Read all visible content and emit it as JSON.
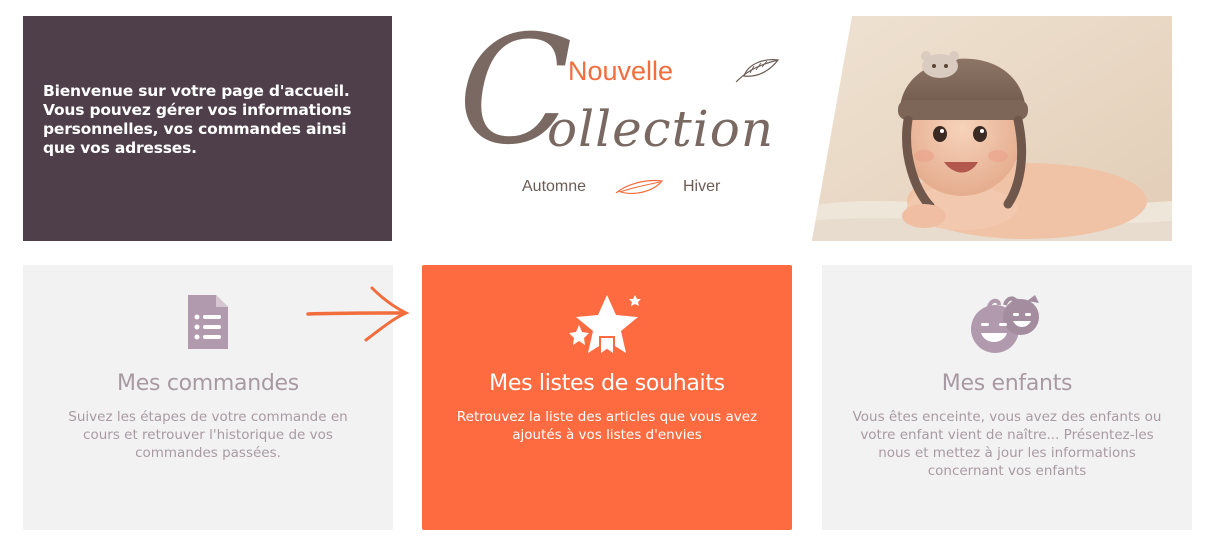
{
  "welcome": {
    "text": "Bienvenue sur votre page d'accueil. Vous pouvez gérer vos informations personnelles, vos commandes ainsi que vos adresses."
  },
  "banner": {
    "nouvelle": "Nouvelle",
    "big_letter": "C",
    "rest": "ollection",
    "season_left": "Automne",
    "season_right": "Hiver",
    "accent_color": "#f26d3d"
  },
  "photo": {
    "icon": "baby-photo"
  },
  "cards": [
    {
      "title": "Mes commandes",
      "description": "Suivez les étapes de votre commande en cours et retrouver l'historique de vos commandes passées.",
      "icon": "document-list-icon"
    },
    {
      "title": "Mes listes de souhaits",
      "description": "Retrouvez la liste des articles que vous avez ajoutés à vos listes d'envies",
      "icon": "stars-icon",
      "color": "#fe6b40"
    },
    {
      "title": "Mes enfants",
      "description": "Vous êtes enceinte, vous avez des enfants ou votre enfant vient de naître... Présentez-les nous et mettez à jour les informations concernant vos enfants",
      "icon": "children-faces-icon"
    }
  ],
  "colors": {
    "welcome_bg": "#4e3f4a",
    "card_grey_bg": "#f3f2f2",
    "card_text": "#a89aa3"
  }
}
